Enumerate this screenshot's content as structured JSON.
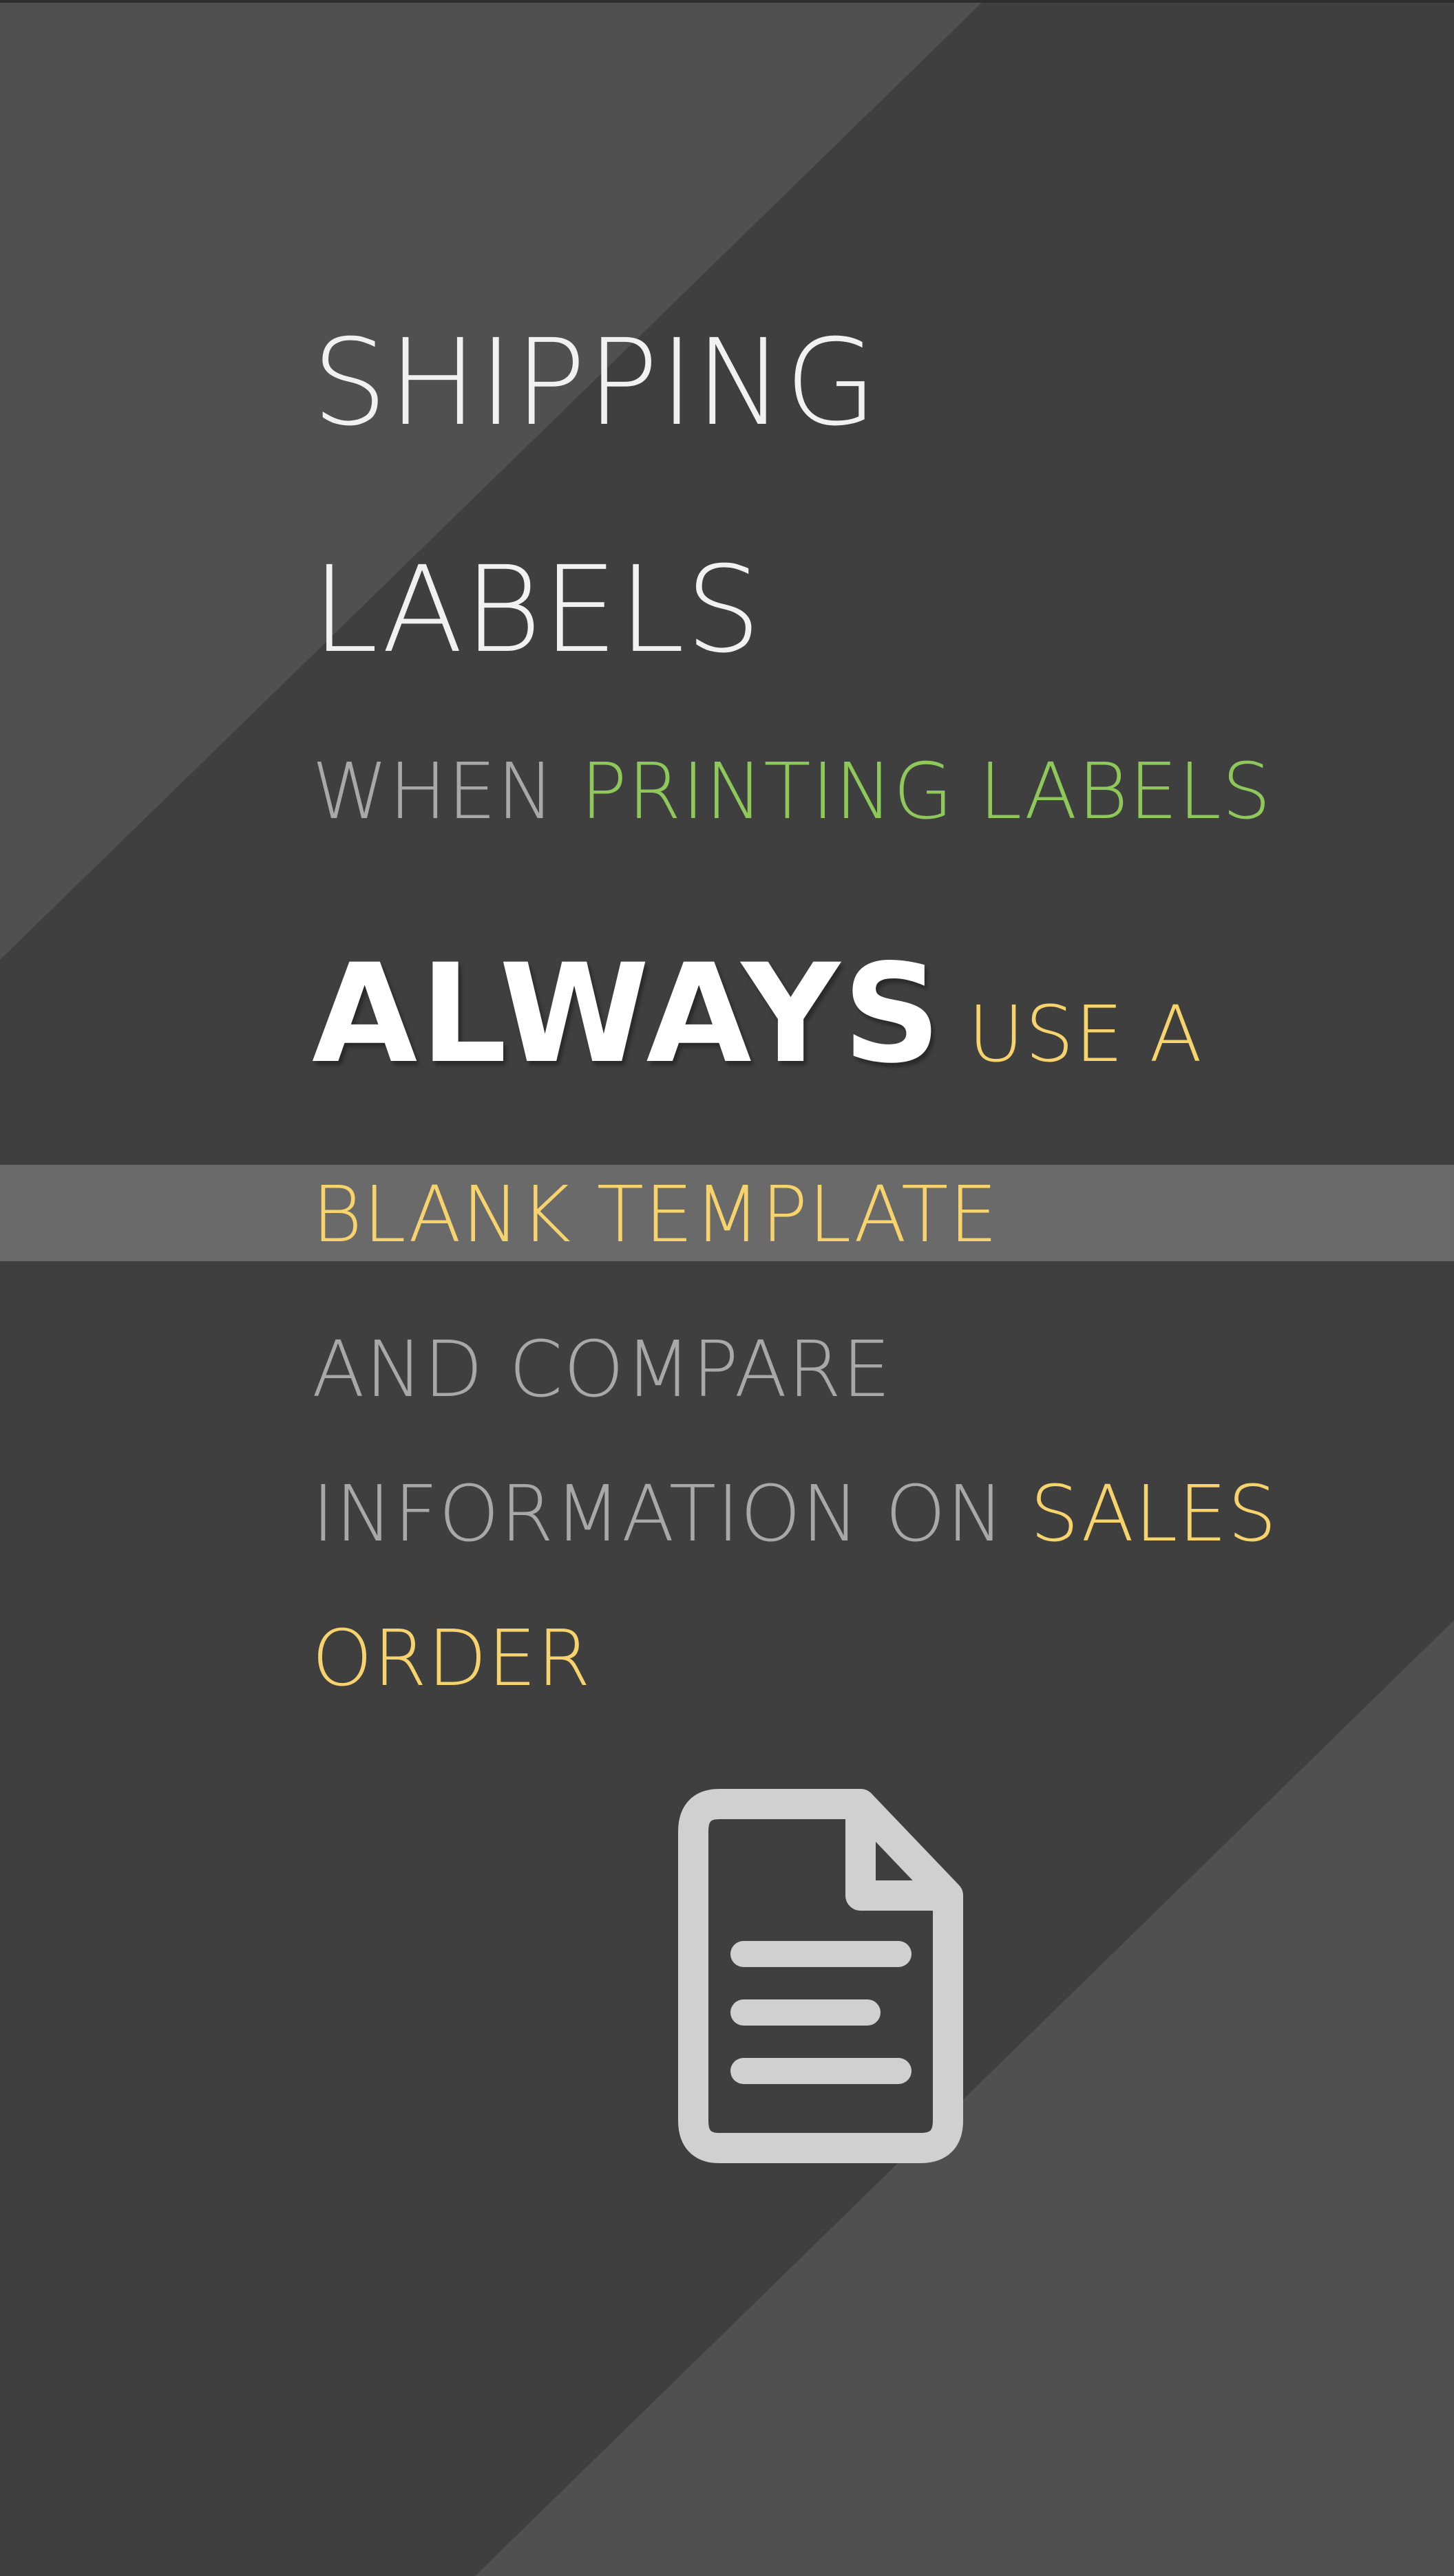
{
  "colors": {
    "background": "#3f3f3f",
    "stripe_light": "#545454",
    "band": "#6a6a6a",
    "headline": "#f1f1f1",
    "gray_text": "#a8a8a8",
    "green": "#8ec85a",
    "yellow": "#f6d36c",
    "white": "#ffffff",
    "icon": "#d0d0d0"
  },
  "headline": {
    "line1": "SHIPPING",
    "line2": "LABELS"
  },
  "line_when": {
    "prefix": "WHEN",
    "highlight": "PRINTING LABELS"
  },
  "line_always": {
    "emphasis": "ALWAYS",
    "suffix": "USE A"
  },
  "line_blank": "BLANK TEMPLATE",
  "line_compare": "AND COMPARE",
  "line_info": {
    "prefix": "INFORMATION ON",
    "highlight": "SALES"
  },
  "line_order": "ORDER",
  "icon": "document-icon"
}
